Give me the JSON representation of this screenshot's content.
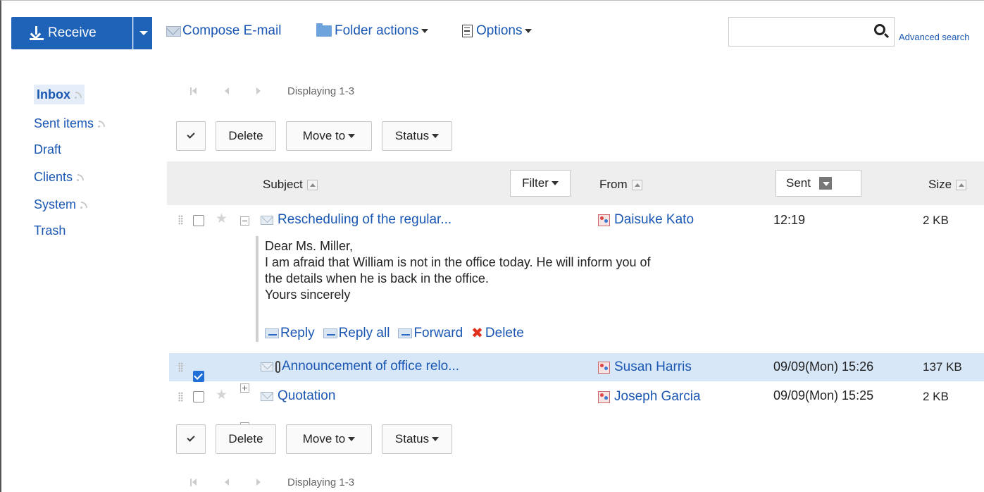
{
  "toolbar": {
    "receive_label": "Receive",
    "compose_label": "Compose E-mail",
    "folder_actions_label": "Folder actions",
    "options_label": "Options",
    "search_value": "",
    "advanced_search_label": "Advanced search"
  },
  "sidebar": {
    "items": [
      {
        "label": "Inbox",
        "rss": true,
        "active": true
      },
      {
        "label": "Sent items",
        "rss": true
      },
      {
        "label": "Draft",
        "rss": false
      },
      {
        "label": "Clients",
        "rss": true
      },
      {
        "label": "System",
        "rss": true
      },
      {
        "label": "Trash",
        "rss": false
      }
    ]
  },
  "pager": {
    "text": "Displaying 1-3"
  },
  "actions": {
    "delete_label": "Delete",
    "move_to_label": "Move to",
    "status_label": "Status"
  },
  "columns": {
    "subject": "Subject",
    "filter": "Filter",
    "from": "From",
    "sent": "Sent",
    "size": "Size"
  },
  "messages": [
    {
      "subject": "Rescheduling of the regular...",
      "from": "Daisuke Kato",
      "sent": "12:19",
      "size": "2 KB",
      "checked": false,
      "expanded": true,
      "attachment": false
    },
    {
      "subject": "Announcement of office relo...",
      "from": "Susan Harris",
      "sent": "09/09(Mon) 15:26",
      "size": "137 KB",
      "checked": true,
      "expanded": false,
      "attachment": true
    },
    {
      "subject": "Quotation",
      "from": "Joseph Garcia",
      "sent": "09/09(Mon) 15:25",
      "size": "2 KB",
      "checked": false,
      "expanded": false,
      "attachment": false
    }
  ],
  "preview": {
    "lines": [
      "Dear Ms. Miller,",
      "I am afraid that William is not in the office today. He will inform you of",
      "the details when he is back in the office.",
      "Yours sincerely"
    ],
    "reply_label": "Reply",
    "reply_all_label": "Reply all",
    "forward_label": "Forward",
    "delete_label": "Delete"
  },
  "colors": {
    "accent": "#1f63b9",
    "link": "#1a57b3",
    "selected_row": "#d8e7f7",
    "header_bg": "#eeeeee"
  }
}
